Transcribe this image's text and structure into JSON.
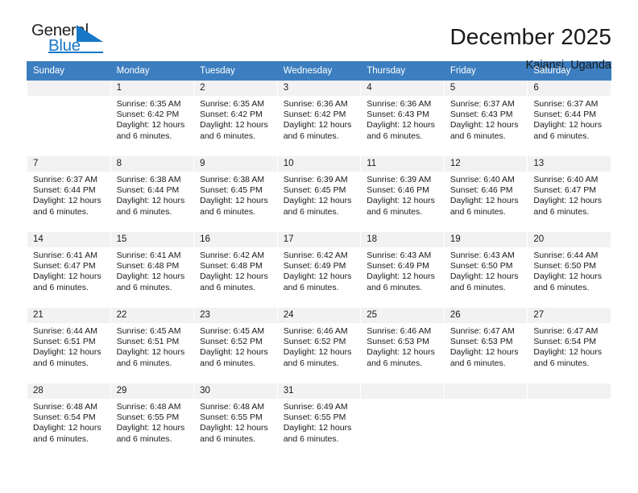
{
  "brand": {
    "name_part1": "General",
    "name_part2": "Blue",
    "triangle_color": "#1878c8",
    "text_color": "#231f20"
  },
  "header": {
    "title": "December 2025",
    "subtitle": "Kajansi, Uganda"
  },
  "theme": {
    "header_bg": "#3c7ebf",
    "header_text": "#ffffff",
    "daynum_bg": "#f2f2f2",
    "cell_bg": "#ffffff",
    "body_text": "#1a1a1a"
  },
  "weekdays": [
    "Sunday",
    "Monday",
    "Tuesday",
    "Wednesday",
    "Thursday",
    "Friday",
    "Saturday"
  ],
  "weeks": [
    [
      {
        "day": "",
        "sunrise": "",
        "sunset": "",
        "daylight_line1": "",
        "daylight_line2": ""
      },
      {
        "day": "1",
        "sunrise": "Sunrise: 6:35 AM",
        "sunset": "Sunset: 6:42 PM",
        "daylight_line1": "Daylight: 12 hours",
        "daylight_line2": "and 6 minutes."
      },
      {
        "day": "2",
        "sunrise": "Sunrise: 6:35 AM",
        "sunset": "Sunset: 6:42 PM",
        "daylight_line1": "Daylight: 12 hours",
        "daylight_line2": "and 6 minutes."
      },
      {
        "day": "3",
        "sunrise": "Sunrise: 6:36 AM",
        "sunset": "Sunset: 6:42 PM",
        "daylight_line1": "Daylight: 12 hours",
        "daylight_line2": "and 6 minutes."
      },
      {
        "day": "4",
        "sunrise": "Sunrise: 6:36 AM",
        "sunset": "Sunset: 6:43 PM",
        "daylight_line1": "Daylight: 12 hours",
        "daylight_line2": "and 6 minutes."
      },
      {
        "day": "5",
        "sunrise": "Sunrise: 6:37 AM",
        "sunset": "Sunset: 6:43 PM",
        "daylight_line1": "Daylight: 12 hours",
        "daylight_line2": "and 6 minutes."
      },
      {
        "day": "6",
        "sunrise": "Sunrise: 6:37 AM",
        "sunset": "Sunset: 6:44 PM",
        "daylight_line1": "Daylight: 12 hours",
        "daylight_line2": "and 6 minutes."
      }
    ],
    [
      {
        "day": "7",
        "sunrise": "Sunrise: 6:37 AM",
        "sunset": "Sunset: 6:44 PM",
        "daylight_line1": "Daylight: 12 hours",
        "daylight_line2": "and 6 minutes."
      },
      {
        "day": "8",
        "sunrise": "Sunrise: 6:38 AM",
        "sunset": "Sunset: 6:44 PM",
        "daylight_line1": "Daylight: 12 hours",
        "daylight_line2": "and 6 minutes."
      },
      {
        "day": "9",
        "sunrise": "Sunrise: 6:38 AM",
        "sunset": "Sunset: 6:45 PM",
        "daylight_line1": "Daylight: 12 hours",
        "daylight_line2": "and 6 minutes."
      },
      {
        "day": "10",
        "sunrise": "Sunrise: 6:39 AM",
        "sunset": "Sunset: 6:45 PM",
        "daylight_line1": "Daylight: 12 hours",
        "daylight_line2": "and 6 minutes."
      },
      {
        "day": "11",
        "sunrise": "Sunrise: 6:39 AM",
        "sunset": "Sunset: 6:46 PM",
        "daylight_line1": "Daylight: 12 hours",
        "daylight_line2": "and 6 minutes."
      },
      {
        "day": "12",
        "sunrise": "Sunrise: 6:40 AM",
        "sunset": "Sunset: 6:46 PM",
        "daylight_line1": "Daylight: 12 hours",
        "daylight_line2": "and 6 minutes."
      },
      {
        "day": "13",
        "sunrise": "Sunrise: 6:40 AM",
        "sunset": "Sunset: 6:47 PM",
        "daylight_line1": "Daylight: 12 hours",
        "daylight_line2": "and 6 minutes."
      }
    ],
    [
      {
        "day": "14",
        "sunrise": "Sunrise: 6:41 AM",
        "sunset": "Sunset: 6:47 PM",
        "daylight_line1": "Daylight: 12 hours",
        "daylight_line2": "and 6 minutes."
      },
      {
        "day": "15",
        "sunrise": "Sunrise: 6:41 AM",
        "sunset": "Sunset: 6:48 PM",
        "daylight_line1": "Daylight: 12 hours",
        "daylight_line2": "and 6 minutes."
      },
      {
        "day": "16",
        "sunrise": "Sunrise: 6:42 AM",
        "sunset": "Sunset: 6:48 PM",
        "daylight_line1": "Daylight: 12 hours",
        "daylight_line2": "and 6 minutes."
      },
      {
        "day": "17",
        "sunrise": "Sunrise: 6:42 AM",
        "sunset": "Sunset: 6:49 PM",
        "daylight_line1": "Daylight: 12 hours",
        "daylight_line2": "and 6 minutes."
      },
      {
        "day": "18",
        "sunrise": "Sunrise: 6:43 AM",
        "sunset": "Sunset: 6:49 PM",
        "daylight_line1": "Daylight: 12 hours",
        "daylight_line2": "and 6 minutes."
      },
      {
        "day": "19",
        "sunrise": "Sunrise: 6:43 AM",
        "sunset": "Sunset: 6:50 PM",
        "daylight_line1": "Daylight: 12 hours",
        "daylight_line2": "and 6 minutes."
      },
      {
        "day": "20",
        "sunrise": "Sunrise: 6:44 AM",
        "sunset": "Sunset: 6:50 PM",
        "daylight_line1": "Daylight: 12 hours",
        "daylight_line2": "and 6 minutes."
      }
    ],
    [
      {
        "day": "21",
        "sunrise": "Sunrise: 6:44 AM",
        "sunset": "Sunset: 6:51 PM",
        "daylight_line1": "Daylight: 12 hours",
        "daylight_line2": "and 6 minutes."
      },
      {
        "day": "22",
        "sunrise": "Sunrise: 6:45 AM",
        "sunset": "Sunset: 6:51 PM",
        "daylight_line1": "Daylight: 12 hours",
        "daylight_line2": "and 6 minutes."
      },
      {
        "day": "23",
        "sunrise": "Sunrise: 6:45 AM",
        "sunset": "Sunset: 6:52 PM",
        "daylight_line1": "Daylight: 12 hours",
        "daylight_line2": "and 6 minutes."
      },
      {
        "day": "24",
        "sunrise": "Sunrise: 6:46 AM",
        "sunset": "Sunset: 6:52 PM",
        "daylight_line1": "Daylight: 12 hours",
        "daylight_line2": "and 6 minutes."
      },
      {
        "day": "25",
        "sunrise": "Sunrise: 6:46 AM",
        "sunset": "Sunset: 6:53 PM",
        "daylight_line1": "Daylight: 12 hours",
        "daylight_line2": "and 6 minutes."
      },
      {
        "day": "26",
        "sunrise": "Sunrise: 6:47 AM",
        "sunset": "Sunset: 6:53 PM",
        "daylight_line1": "Daylight: 12 hours",
        "daylight_line2": "and 6 minutes."
      },
      {
        "day": "27",
        "sunrise": "Sunrise: 6:47 AM",
        "sunset": "Sunset: 6:54 PM",
        "daylight_line1": "Daylight: 12 hours",
        "daylight_line2": "and 6 minutes."
      }
    ],
    [
      {
        "day": "28",
        "sunrise": "Sunrise: 6:48 AM",
        "sunset": "Sunset: 6:54 PM",
        "daylight_line1": "Daylight: 12 hours",
        "daylight_line2": "and 6 minutes."
      },
      {
        "day": "29",
        "sunrise": "Sunrise: 6:48 AM",
        "sunset": "Sunset: 6:55 PM",
        "daylight_line1": "Daylight: 12 hours",
        "daylight_line2": "and 6 minutes."
      },
      {
        "day": "30",
        "sunrise": "Sunrise: 6:48 AM",
        "sunset": "Sunset: 6:55 PM",
        "daylight_line1": "Daylight: 12 hours",
        "daylight_line2": "and 6 minutes."
      },
      {
        "day": "31",
        "sunrise": "Sunrise: 6:49 AM",
        "sunset": "Sunset: 6:55 PM",
        "daylight_line1": "Daylight: 12 hours",
        "daylight_line2": "and 6 minutes."
      },
      {
        "day": "",
        "sunrise": "",
        "sunset": "",
        "daylight_line1": "",
        "daylight_line2": ""
      },
      {
        "day": "",
        "sunrise": "",
        "sunset": "",
        "daylight_line1": "",
        "daylight_line2": ""
      },
      {
        "day": "",
        "sunrise": "",
        "sunset": "",
        "daylight_line1": "",
        "daylight_line2": ""
      }
    ]
  ]
}
